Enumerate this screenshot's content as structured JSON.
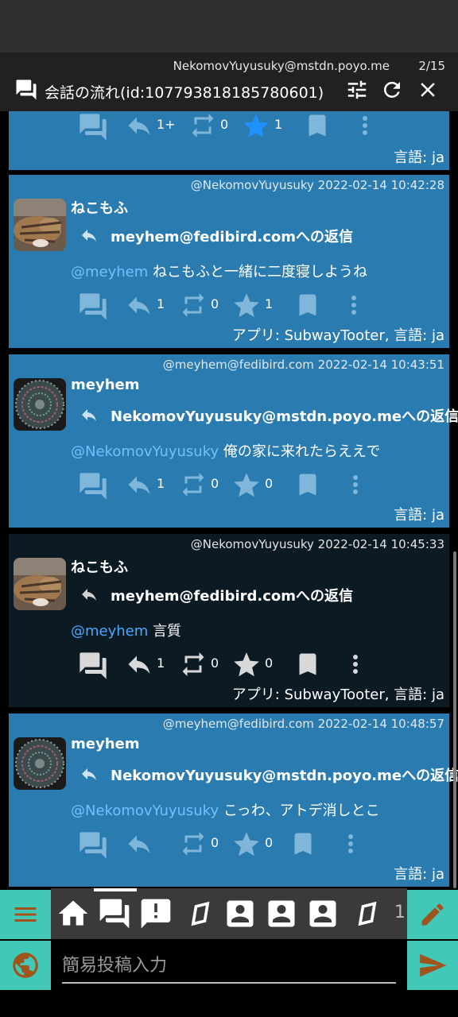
{
  "header": {
    "account": "NekomovYuyusuky@mstdn.poyo.me",
    "position": "2/15",
    "title": "会話の流れ(id:107793818185780601)"
  },
  "colors": {
    "card": "#2a7bb0",
    "card_selected": "#0c1a24",
    "accent_side": "#41c8b6",
    "mention": "#6ec3ff"
  },
  "cards": [
    {
      "reply_count": "1+",
      "boost_count": "0",
      "fav_count": "1",
      "footer": "言語: ja"
    },
    {
      "meta": "@NekomovYuyusuky  2022-02-14 10:42:28",
      "name": "ねこもふ",
      "reply_to": "meyhem@fedibird.comへの返信",
      "mention": "@meyhem",
      "text": " ねこもふと一緒に二度寝しようね",
      "reply_count": "1",
      "boost_count": "0",
      "fav_count": "1",
      "footer": "アプリ: SubwayTooter, 言語: ja"
    },
    {
      "meta": "@meyhem@fedibird.com  2022-02-14 10:43:51",
      "name": "meyhem",
      "reply_to": "NekomovYuyusuky@mstdn.poyo.meへの返信",
      "mention": "@NekomovYuyusuky",
      "text": " 俺の家に来れたらええで",
      "reply_count": "1",
      "boost_count": "0",
      "fav_count": "0",
      "footer": "言語: ja"
    },
    {
      "meta": "@NekomovYuyusuky  2022-02-14 10:45:33",
      "name": "ねこもふ",
      "reply_to": "meyhem@fedibird.comへの返信",
      "mention": "@meyhem",
      "text": " 言質",
      "reply_count": "1",
      "boost_count": "0",
      "fav_count": "0",
      "footer": "アプリ: SubwayTooter, 言語: ja"
    },
    {
      "meta": "@meyhem@fedibird.com  2022-02-14 10:48:57",
      "name": "meyhem",
      "reply_to": "NekomovYuyusuky@mstdn.poyo.meへの返信",
      "mention": "@NekomovYuyusuky",
      "text": " こっわ、アトデ消しとこ",
      "reply_count": "",
      "boost_count": "0",
      "fav_count": "0",
      "footer": "言語: ja"
    }
  ],
  "tabs": [
    "home-icon",
    "conversation-icon",
    "notification-icon",
    "tag-icon",
    "profile-icon",
    "profile-icon",
    "profile-icon",
    "tag-icon"
  ],
  "tab_overflow_text": "1",
  "postbox": {
    "placeholder": "簡易投稿入力"
  }
}
